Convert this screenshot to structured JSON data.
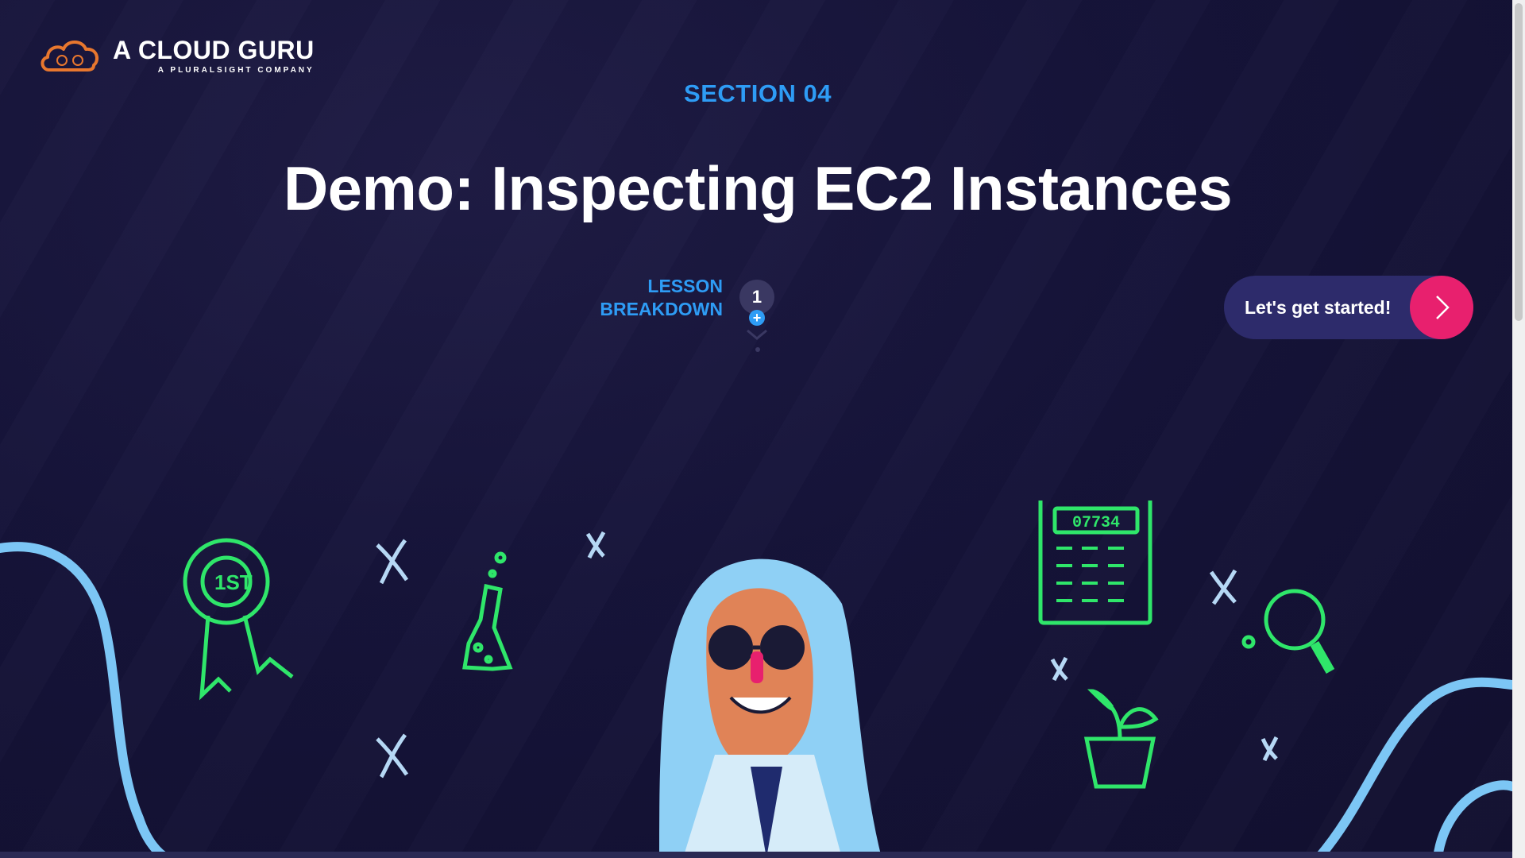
{
  "logo": {
    "title": "A CLOUD GURU",
    "subtitle": "A PLURALSIGHT COMPANY"
  },
  "section": {
    "label": "SECTION 04"
  },
  "lesson": {
    "title": "Demo: Inspecting EC2 Instances"
  },
  "breakdown": {
    "line1": "LESSON",
    "line2": "BREAKDOWN",
    "count": "1"
  },
  "cta": {
    "label": "Let's get started!"
  },
  "calculator": {
    "display": "07734"
  },
  "award": {
    "text": "1ST"
  },
  "colors": {
    "accent_blue": "#2e9cf5",
    "accent_pink": "#e8206e",
    "doodle_green": "#2fe66a",
    "cloud_orange": "#e8772e"
  }
}
